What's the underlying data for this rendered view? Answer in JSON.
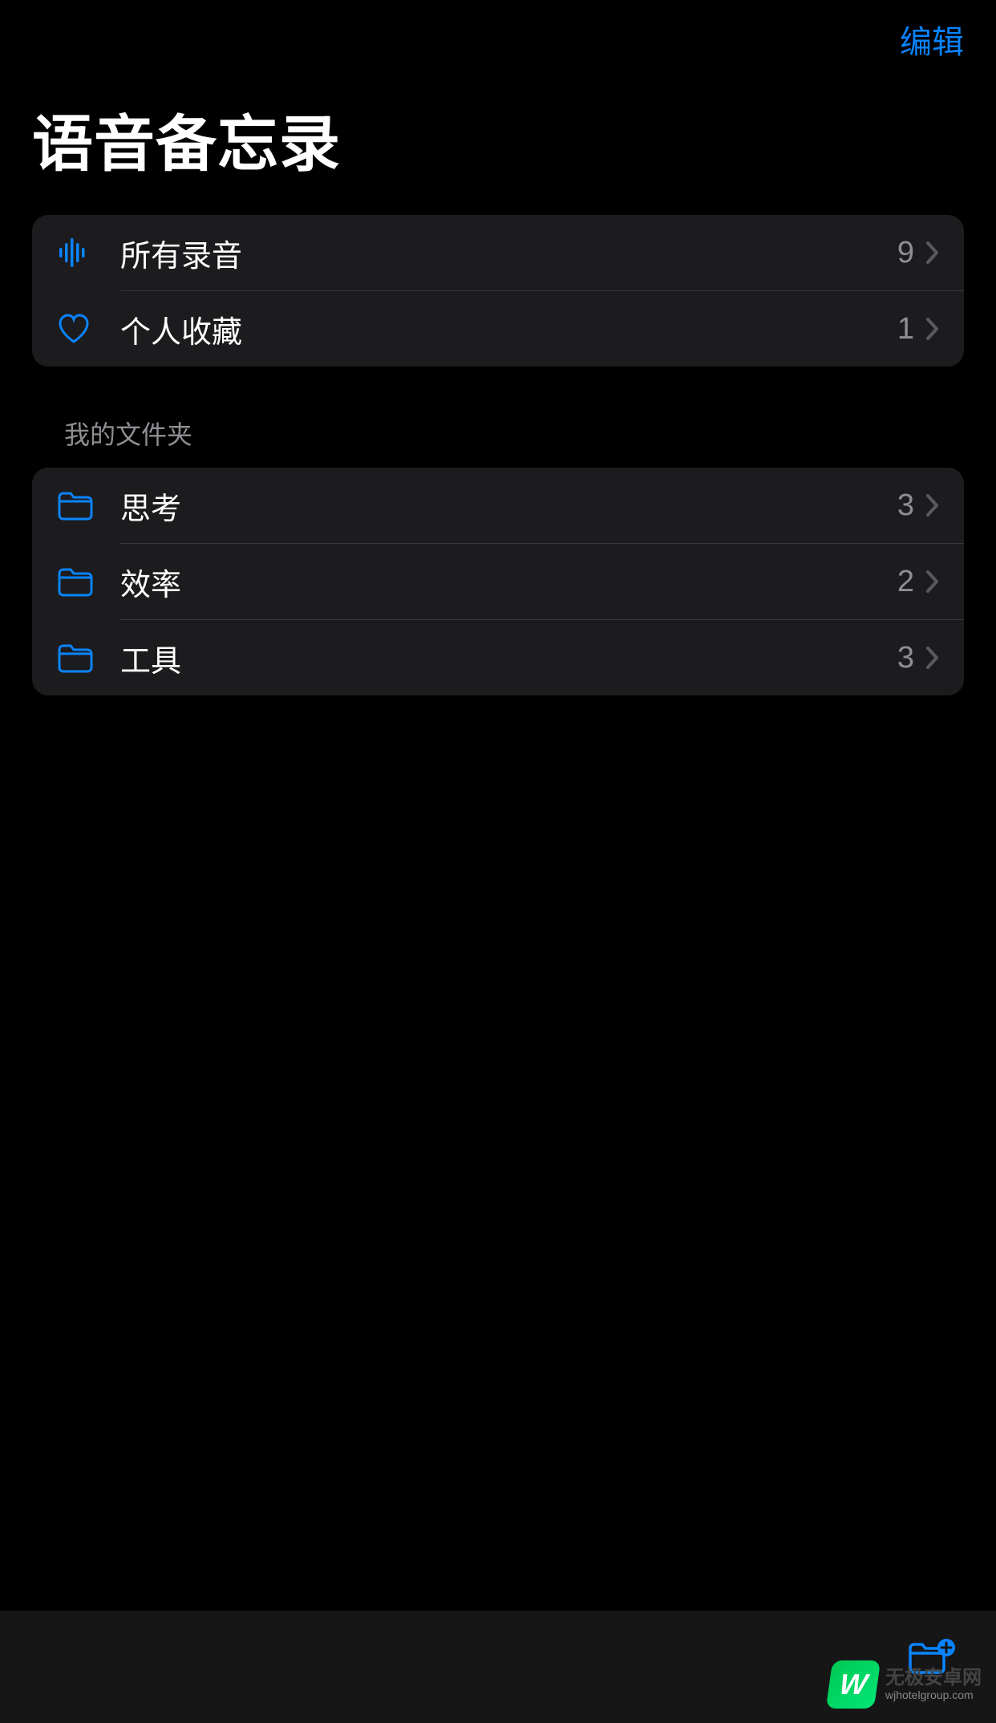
{
  "nav": {
    "edit_label": "编辑"
  },
  "title": "语音备忘录",
  "smart_lists": [
    {
      "icon": "waveform",
      "label": "所有录音",
      "count": "9"
    },
    {
      "icon": "heart",
      "label": "个人收藏",
      "count": "1"
    }
  ],
  "section_header": "我的文件夹",
  "folders": [
    {
      "icon": "folder",
      "label": "思考",
      "count": "3"
    },
    {
      "icon": "folder",
      "label": "效率",
      "count": "2"
    },
    {
      "icon": "folder",
      "label": "工具",
      "count": "3"
    }
  ],
  "watermark": {
    "logo_letter": "W",
    "main": "无极安卓网",
    "sub": "wjhotelgroup.com"
  },
  "colors": {
    "accent": "#0a84ff",
    "background": "#000000",
    "cell": "#1c1c1e",
    "secondary_text": "#8e8e93"
  }
}
